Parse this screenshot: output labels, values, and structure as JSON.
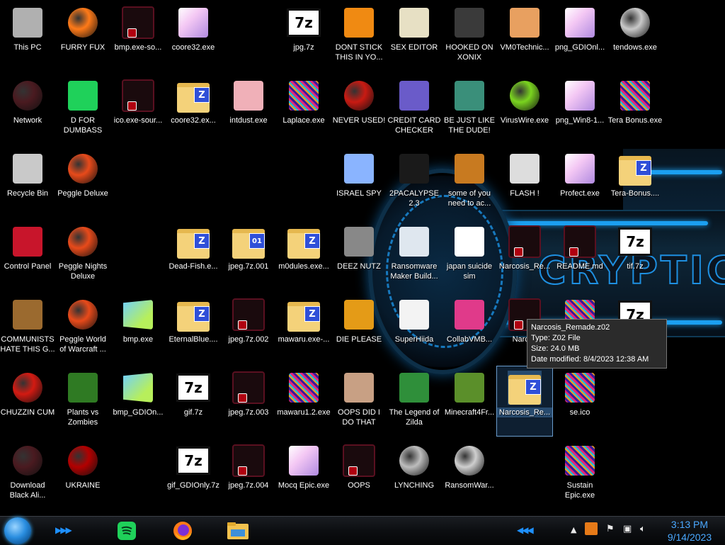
{
  "desktop_icons": [
    {
      "label": "This PC",
      "icon": "computer-icon"
    },
    {
      "label": "FURRY FUX",
      "icon": "firefox-icon"
    },
    {
      "label": "bmp.exe-so...",
      "icon": "exe-icon"
    },
    {
      "label": "coore32.exe",
      "icon": "anime-image-icon"
    },
    {
      "label": "jpg.7z",
      "icon": "7z-archive-icon"
    },
    {
      "label": "DONT STICK THIS IN YO...",
      "icon": "vlc-icon"
    },
    {
      "label": "SEX EDITOR",
      "icon": "hex-editor-icon"
    },
    {
      "label": "HOOKED ON XONIX",
      "icon": "xonix-icon"
    },
    {
      "label": "VM0Technic...",
      "icon": "person-icon"
    },
    {
      "label": "png_GDIOnl...",
      "icon": "anime-image-icon"
    },
    {
      "label": "tendows.exe",
      "icon": "disc-icon"
    },
    {
      "label": "Network",
      "icon": "network-icon"
    },
    {
      "label": "D FOR DUMBASS",
      "icon": "spotify-icon"
    },
    {
      "label": "ico.exe-sour...",
      "icon": "exe-icon"
    },
    {
      "label": "coore32.ex...",
      "icon": "zipped-folder-icon"
    },
    {
      "label": "intdust.exe",
      "icon": "paint-palette-icon"
    },
    {
      "label": "Laplace.exe",
      "icon": "noise-icon"
    },
    {
      "label": "NEVER USED!",
      "icon": "devcpp-icon"
    },
    {
      "label": "CREDIT CARD CHECKER",
      "icon": "credit-card-icon"
    },
    {
      "label": "BE JUST LIKE THE DUDE!",
      "icon": "santa-icon"
    },
    {
      "label": "VirusWire.exe",
      "icon": "lime-icon"
    },
    {
      "label": "png_Win8-1...",
      "icon": "anime-image-icon"
    },
    {
      "label": "Tera Bonus.exe",
      "icon": "noise-icon"
    },
    {
      "label": "Recycle Bin",
      "icon": "recycle-bin-icon"
    },
    {
      "label": "Peggle Deluxe",
      "icon": "peggle-icon"
    },
    {
      "label": "ISRAEL SPY",
      "icon": "spy-icon"
    },
    {
      "label": "2PACALYPSE 2.3",
      "icon": "terminal-icon"
    },
    {
      "label": "some of you need to ac...",
      "icon": "beaver-icon"
    },
    {
      "label": "FLASH !",
      "icon": "flash-icon"
    },
    {
      "label": "Profect.exe",
      "icon": "anime-image-icon"
    },
    {
      "label": "Tera-Bonus....",
      "icon": "zipped-folder-icon"
    },
    {
      "label": "Control Panel",
      "icon": "control-panel-icon"
    },
    {
      "label": "Peggle Nights Deluxe",
      "icon": "peggle-icon"
    },
    {
      "label": "Dead-Fish.e...",
      "icon": "zipped-folder-icon"
    },
    {
      "label": "jpeg.7z.001",
      "icon": "split-archive-icon"
    },
    {
      "label": "m0dules.exe...",
      "icon": "zipped-folder-icon"
    },
    {
      "label": "DEEZ NUTZ",
      "icon": "windows-stack-icon"
    },
    {
      "label": "Ransomware Maker Build...",
      "icon": "window-app-icon"
    },
    {
      "label": "japan suicide sim",
      "icon": "document-icon"
    },
    {
      "label": "Narcosis_Re...",
      "icon": "exe-icon"
    },
    {
      "label": "README.md",
      "icon": "exe-icon"
    },
    {
      "label": "tif.7z",
      "icon": "7z-archive-icon"
    },
    {
      "label": "COMMUNISTS HATE THIS G...",
      "icon": "money-bag-icon"
    },
    {
      "label": "Peggle World of Warcraft ...",
      "icon": "peggle-icon"
    },
    {
      "label": "bmp.exe",
      "icon": "image-icon"
    },
    {
      "label": "EternalBlue....",
      "icon": "zipped-folder-icon"
    },
    {
      "label": "jpeg.7z.002",
      "icon": "exe-icon"
    },
    {
      "label": "mawaru.exe-...",
      "icon": "zipped-folder-icon"
    },
    {
      "label": "DIE PLEASE",
      "icon": "de-icon"
    },
    {
      "label": "SuperHiida",
      "icon": "dog-icon"
    },
    {
      "label": "CollabVMB...",
      "icon": "monitor-icon"
    },
    {
      "label": "Narcos",
      "icon": "exe-icon"
    },
    {
      "label": "",
      "icon": "noise-icon"
    },
    {
      "label": "",
      "icon": "7z-archive-icon"
    },
    {
      "label": "CHUZZIN CUM",
      "icon": "chuzzle-icon"
    },
    {
      "label": "Plants vs Zombies",
      "icon": "plant-icon"
    },
    {
      "label": "bmp_GDIOn...",
      "icon": "image-icon"
    },
    {
      "label": "gif.7z",
      "icon": "7z-archive-icon"
    },
    {
      "label": "jpeg.7z.003",
      "icon": "exe-icon"
    },
    {
      "label": "mawaru1.2.exe",
      "icon": "noise-icon"
    },
    {
      "label": "OOPS DID I DO THAT",
      "icon": "portrait-icon"
    },
    {
      "label": "The Legend of Zilda",
      "icon": "zelda-icon"
    },
    {
      "label": "Minecraft4Fr...",
      "icon": "minecraft-icon"
    },
    {
      "label": "Narcosis_Re...",
      "icon": "zipped-folder-icon"
    },
    {
      "label": "se.ico",
      "icon": "noise-icon"
    },
    {
      "label": "Download Black Ali...",
      "icon": "network-icon"
    },
    {
      "label": "UKRAINE",
      "icon": "radiation-icon"
    },
    {
      "label": "gif_GDIOnly.7z",
      "icon": "7z-archive-icon"
    },
    {
      "label": "jpeg.7z.004",
      "icon": "exe-icon"
    },
    {
      "label": "Mocq Epic.exe",
      "icon": "anime-image-icon"
    },
    {
      "label": "OOPS",
      "icon": "exe-icon"
    },
    {
      "label": "LYNCHING",
      "icon": "gear-icon"
    },
    {
      "label": "RansomWar...",
      "icon": "skull-icon"
    },
    {
      "label": "Sustain Epic.exe",
      "icon": "noise-icon"
    }
  ],
  "tooltip": {
    "name": "Narcosis_Remade.z02",
    "type": "Type: Z02 File",
    "size": "Size: 24.0 MB",
    "modified": "Date modified: 8/4/2023 12:38 AM"
  },
  "wallpaper": {
    "word": "CRYPTIC"
  },
  "taskbar": {
    "pinned": [
      {
        "name": "spotify",
        "icon": "spotify-icon"
      },
      {
        "name": "firefox",
        "icon": "firefox-icon"
      },
      {
        "name": "file-explorer",
        "icon": "folder-icon"
      }
    ],
    "tray_icons": [
      "chevron-up-icon",
      "flag-icon",
      "network-icon",
      "volume-icon"
    ],
    "clock": {
      "time": "3:13 PM",
      "date": "9/14/2023"
    }
  }
}
